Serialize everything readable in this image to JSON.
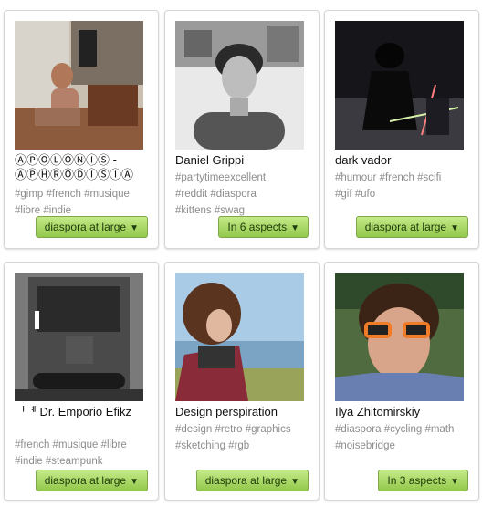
{
  "cards": [
    {
      "name": "ⒶⓅⓄⓁⓄⓃⒾⓈ - ⒶⓅⒽⓇⓄⒹⒾⓈⒾⒶ",
      "tags_line1": "#gimp #french #musique",
      "tags_line2": "#libre #indie",
      "tags_line3": "",
      "aspect_label": "diaspora at large",
      "caret": "▼"
    },
    {
      "name": "Daniel Grippi",
      "tags_line1": "#partytimeexcellent",
      "tags_line2": "#reddit #diaspora",
      "tags_line3": "#kittens #swag",
      "aspect_label": "In 6 aspects",
      "caret": "▼"
    },
    {
      "name": "dark vador",
      "tags_line1": "#humour #french #scifi",
      "tags_line2": "#gif #ufo",
      "tags_line3": "",
      "aspect_label": "diaspora at large",
      "caret": "▼"
    },
    {
      "name": "ᅵᅨ Dr. Emporio Efikz",
      "tags_line1": "#french #musique #libre",
      "tags_line2": "#indie #steampunk",
      "tags_line3": "",
      "aspect_label": "diaspora at large",
      "caret": "▼"
    },
    {
      "name": "Design perspiration",
      "tags_line1": "#design #retro #graphics",
      "tags_line2": "#sketching #rgb",
      "tags_line3": "",
      "aspect_label": "diaspora at large",
      "caret": "▼"
    },
    {
      "name": "Ilya Zhitomirskiy",
      "tags_line1": "#diaspora #cycling #math",
      "tags_line2": "#noisebridge",
      "tags_line3": "",
      "aspect_label": "In 3 aspects",
      "caret": "▼"
    }
  ]
}
